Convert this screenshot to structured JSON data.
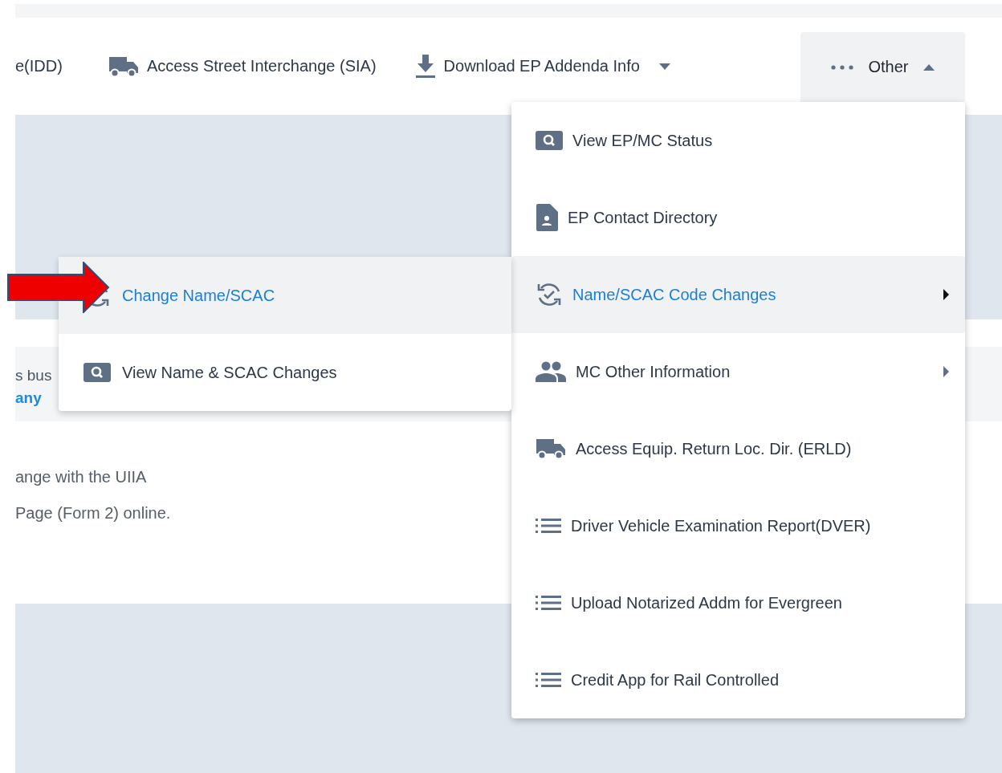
{
  "nav": {
    "items": [
      {
        "kind": "text",
        "label": "e(IDD)"
      },
      {
        "kind": "truck",
        "label": "Access Street Interchange (SIA)"
      },
      {
        "kind": "download",
        "label": "Download EP Addenda Info",
        "expanded": false
      }
    ],
    "other": {
      "label": "Other",
      "expanded": true
    }
  },
  "background": {
    "card_texts": [
      {
        "kind": "plain",
        "text": "s bus"
      },
      {
        "kind": "link",
        "text": "any"
      }
    ],
    "lines": [
      "ange with the UIIA",
      "Page (Form 2) online."
    ]
  },
  "menu": {
    "items": [
      {
        "kind": "search",
        "label": "View EP/MC Status",
        "selected": false,
        "submenu": false
      },
      {
        "kind": "contact",
        "label": "EP Contact Directory",
        "selected": false,
        "submenu": false
      },
      {
        "kind": "sync",
        "label": "Name/SCAC Code Changes",
        "selected": true,
        "submenu": true
      },
      {
        "kind": "people",
        "label": "MC Other Information",
        "selected": false,
        "submenu": true
      },
      {
        "kind": "truck",
        "label": "Access Equip. Return Loc. Dir. (ERLD)",
        "selected": false,
        "submenu": false
      },
      {
        "kind": "list",
        "label": "Driver Vehicle Examination Report(DVER)",
        "selected": false,
        "submenu": false
      },
      {
        "kind": "list",
        "label": "Upload Notarized Addm for Evergreen",
        "selected": false,
        "submenu": false
      },
      {
        "kind": "list",
        "label": "Credit App for Rail Controlled",
        "selected": false,
        "submenu": false
      }
    ]
  },
  "submenu": {
    "items": [
      {
        "kind": "sync",
        "label": "Change Name/SCAC",
        "selected": true
      },
      {
        "kind": "search",
        "label": "View Name & SCAC Changes",
        "selected": false
      }
    ]
  }
}
